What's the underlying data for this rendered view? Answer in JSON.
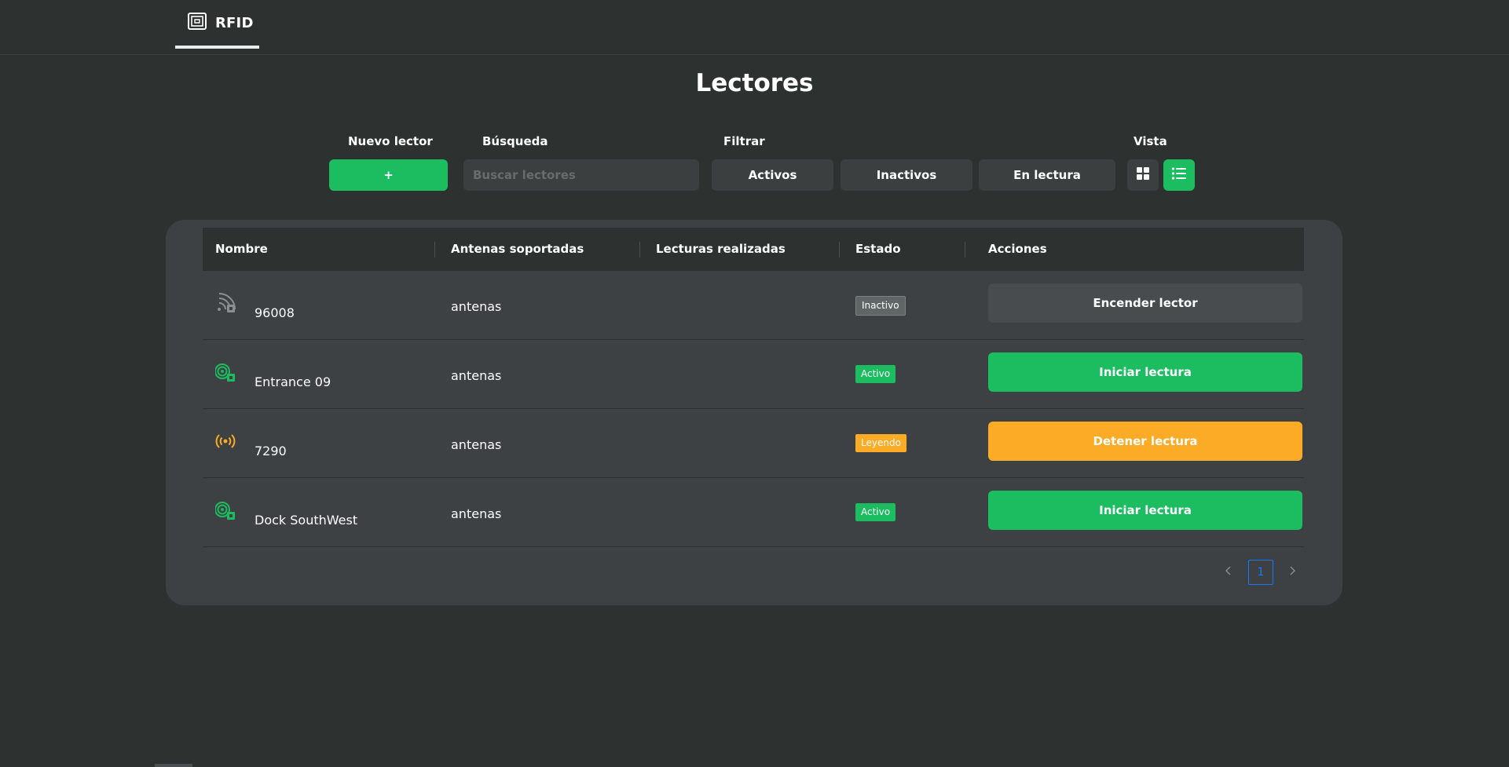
{
  "app": {
    "title": "RFID",
    "logo_icon": "rfid-chip-icon"
  },
  "page": {
    "title": "Lectores"
  },
  "toolbar": {
    "new_label": "Nuevo lector",
    "new_button": "+",
    "search_label": "Búsqueda",
    "search_placeholder": "Buscar lectores",
    "search_value": "",
    "filter_label": "Filtrar",
    "filters": [
      "Activos",
      "Inactivos",
      "En lectura"
    ],
    "view_label": "Vista",
    "view_modes": [
      {
        "icon": "grid-icon",
        "active": false
      },
      {
        "icon": "list-icon",
        "active": true
      }
    ]
  },
  "table": {
    "columns": [
      "Nombre",
      "Antenas soportadas",
      "Lecturas realizadas",
      "Estado",
      "Acciones"
    ],
    "rows": [
      {
        "name": "96008",
        "antennas": "antenas",
        "readings": "",
        "status": "Inactivo",
        "action": "Encender lector",
        "icon": "reader-inactive-icon"
      },
      {
        "name": "Entrance 09",
        "antennas": "antenas",
        "readings": "",
        "status": "Activo",
        "action": "Iniciar lectura",
        "icon": "reader-active-icon"
      },
      {
        "name": "7290",
        "antennas": "antenas",
        "readings": "",
        "status": "Leyendo",
        "action": "Detener lectura",
        "icon": "reader-reading-icon"
      },
      {
        "name": "Dock SouthWest",
        "antennas": "antenas",
        "readings": "",
        "status": "Activo",
        "action": "Iniciar lectura",
        "icon": "reader-active-icon"
      }
    ]
  },
  "pagination": {
    "current": "1",
    "prev_icon": "chevron-left-icon",
    "next_icon": "chevron-right-icon"
  },
  "colors": {
    "background": "#2d3130",
    "panel": "#3d4143",
    "green": "#1bbd60",
    "orange": "#fbab25",
    "inactive": "#606566",
    "accent_blue": "#1677ff"
  }
}
